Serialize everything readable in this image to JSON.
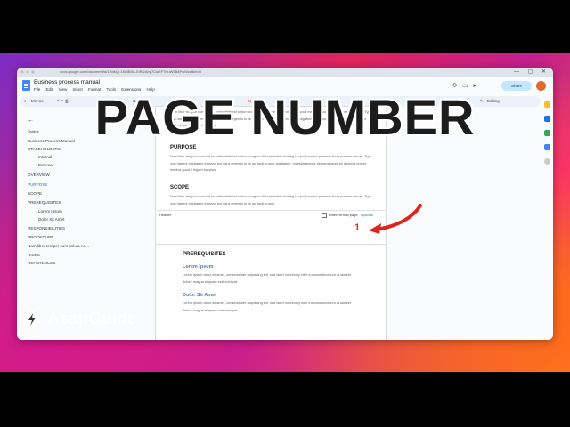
{
  "browser": {
    "url": "docs.google.com/document/d/1RdkQr-1KMEfAj-J0RI2Ahp7ClaEF7HuW3B4PwWzdtk/edit"
  },
  "doc": {
    "title": "Business process manual",
    "menus": [
      "File",
      "Edit",
      "View",
      "Insert",
      "Format",
      "Tools",
      "Extensions",
      "Help"
    ],
    "share_label": "Share",
    "editing_label": "Editing",
    "toolbar": {
      "menus_label": "Menus",
      "zoom": "100%",
      "style": "Norm"
    }
  },
  "outline": {
    "header": "Outline",
    "items": [
      {
        "label": "Business Process Manual",
        "level": 0,
        "active": false
      },
      {
        "label": "STAKEHOLDERS",
        "level": 0,
        "active": false
      },
      {
        "label": "Internal",
        "level": 1,
        "active": false
      },
      {
        "label": "External",
        "level": 1,
        "active": false
      },
      {
        "label": "OVERVIEW",
        "level": 0,
        "active": false
      },
      {
        "label": "PURPOSE",
        "level": 0,
        "active": true
      },
      {
        "label": "SCOPE",
        "level": 0,
        "active": false
      },
      {
        "label": "PREREQUISITES",
        "level": 0,
        "active": false
      },
      {
        "label": "Lorem Ipsum",
        "level": 1,
        "active": false
      },
      {
        "label": "Dolor Sit Amet",
        "level": 1,
        "active": false
      },
      {
        "label": "RESPONSIBILITIES",
        "level": 0,
        "active": false
      },
      {
        "label": "PROCEDURE",
        "level": 0,
        "active": false
      },
      {
        "label": "Nam liber tempor cum soluta no...",
        "level": 0,
        "active": false
      },
      {
        "label": "RISKS",
        "level": 0,
        "active": false
      },
      {
        "label": "REFERENCES",
        "level": 0,
        "active": false
      }
    ]
  },
  "page1": {
    "top_text": "Nam liber tempor cum soluta nobis eleifend option congue nihil imperdiet doming id quod mazim placerat facer possim assum. Typi non habent claritatem insitam; est usus legentis in iis qui facit eorum claritatem. Investigationes demonstraverunt lectores legere me lius quod ii legunt saepius.",
    "purpose_heading": "PURPOSE",
    "purpose_text": "Nam liber tempor cum soluta nobis eleifend option congue nihil imperdiet doming id quod mazim placerat facer possim assum. Typi non habent claritatem insitam; est usus legentis in iis qui facit eorum claritatem. Investigationes demonstraverunt lectores legere me lius quod ii legunt saepius.",
    "scope_heading": "SCOPE",
    "scope_text": "Nam liber tempor cum soluta nobis eleifend option congue nihil imperdiet doming id quod mazim placerat facer possim assum. Typi non habent claritatem insitam; est usus legentis in iis qui facit eorum",
    "header_label": "Header",
    "different_first_page": "Different first page",
    "options_label": "Options",
    "page_number": "1"
  },
  "page2": {
    "heading": "PREREQUISITES",
    "sub1": "Lorem Ipsum",
    "sub1_text": "Lorem ipsum dolor sit amet, consectetuer adipiscing elit, sed diam nonummy nibh euismod tincidunt ut laoreet dolore magna aliquam erat volutpat.",
    "sub2": "Dolor Sit Amet",
    "sub2_text": "Lorem ipsum dolor sit amet, consectetuer adipiscing elit, sed diam nonummy nibh euismod tincidunt ut laoreet dolore magna aliquam erat volutpat."
  },
  "overlay": {
    "title": "PAGE NUMBER",
    "brand": "AsapGuide",
    "arrow_color": "#e0241b"
  }
}
